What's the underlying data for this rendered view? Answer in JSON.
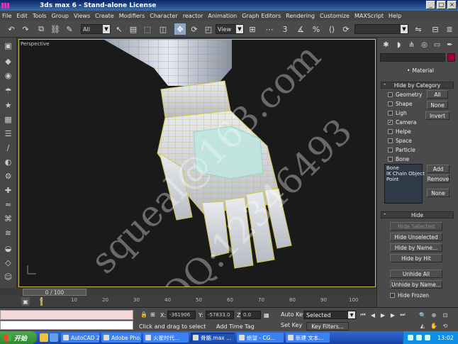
{
  "window": {
    "title": "3ds max 6 - Stand-alone License",
    "controls": [
      "_",
      "□",
      "×"
    ]
  },
  "menu": [
    "File",
    "Edit",
    "Tools",
    "Group",
    "Views",
    "Create",
    "Modifiers",
    "Character",
    "reactor",
    "Animation",
    "Graph Editors",
    "Rendering",
    "Customize",
    "MAXScript",
    "Help"
  ],
  "toolbar": {
    "selection_filter": "All",
    "ref_coord": "View",
    "snap_value": "3"
  },
  "viewport": {
    "label": "Perspective",
    "watermark_1": "squeal@163.com",
    "watermark_2": "QQ:12346493"
  },
  "command_panel": {
    "tab_icons": [
      "create-icon",
      "modify-icon",
      "hierarchy-icon",
      "motion-icon",
      "display-icon",
      "utilities-icon"
    ],
    "display_color_label": "Object",
    "material_radio": "Material",
    "hide_by_category": {
      "title": "Hide by Category",
      "items": [
        {
          "label": "Geometry",
          "checked": false
        },
        {
          "label": "Shape",
          "checked": false
        },
        {
          "label": "Ligh",
          "checked": false
        },
        {
          "label": "Camera",
          "checked": true
        },
        {
          "label": "Helpe",
          "checked": false
        },
        {
          "label": "Space",
          "checked": false
        },
        {
          "label": "Particle",
          "checked": false
        },
        {
          "label": "Bone",
          "checked": false
        }
      ],
      "btn_all": "All",
      "btn_none": "None",
      "btn_invert": "Invert",
      "list": [
        "Bone",
        "IK Chain Object",
        "Point"
      ],
      "btn_add": "Add",
      "btn_remove": "Remove",
      "btn_none2": "None"
    },
    "hide": {
      "title": "Hide",
      "hide_selected": "Hide Selected",
      "hide_unselected": "Hide Unselected",
      "hide_by_name": "Hide by Name...",
      "hide_by_hit": "Hide by Hit",
      "unhide_all": "Unhide All",
      "unhide_by_name": "Unhide by Name...",
      "hide_frozen": "Hide Frozen"
    }
  },
  "timeline": {
    "slider": "0 / 100",
    "ticks": [
      "0",
      "10",
      "20",
      "30",
      "40",
      "50",
      "60",
      "70",
      "80",
      "90",
      "100"
    ]
  },
  "status": {
    "x_label": "X:",
    "x_value": "-361906",
    "y_label": "Y:",
    "y_value": "-57833.0",
    "z_label": "Z:",
    "z_value": "0.0",
    "prompt": "Click and drag to select",
    "add_time_tag": "Add Time Tag",
    "auto_key": "Auto Key",
    "set_key": "Set Key",
    "key_filters": "Key Filters...",
    "selected": "Selected"
  },
  "taskbar": {
    "start": "开始",
    "tasks": [
      {
        "label": "AutoCAD 2...",
        "active": false
      },
      {
        "label": "Adobe Pho...",
        "active": false
      },
      {
        "label": "火星时代...",
        "active": false
      },
      {
        "label": "骨骼.max ...",
        "active": true
      },
      {
        "label": "绝望 - CG...",
        "active": false
      },
      {
        "label": "新建 文本...",
        "active": false
      }
    ],
    "clock": "13:02"
  },
  "colors": {
    "selection_wire": "#d4c54a",
    "mesh_wire": "#5a8ad8",
    "accent_swatch": "#a0003a",
    "xp_blue": "#2b5fcf"
  }
}
